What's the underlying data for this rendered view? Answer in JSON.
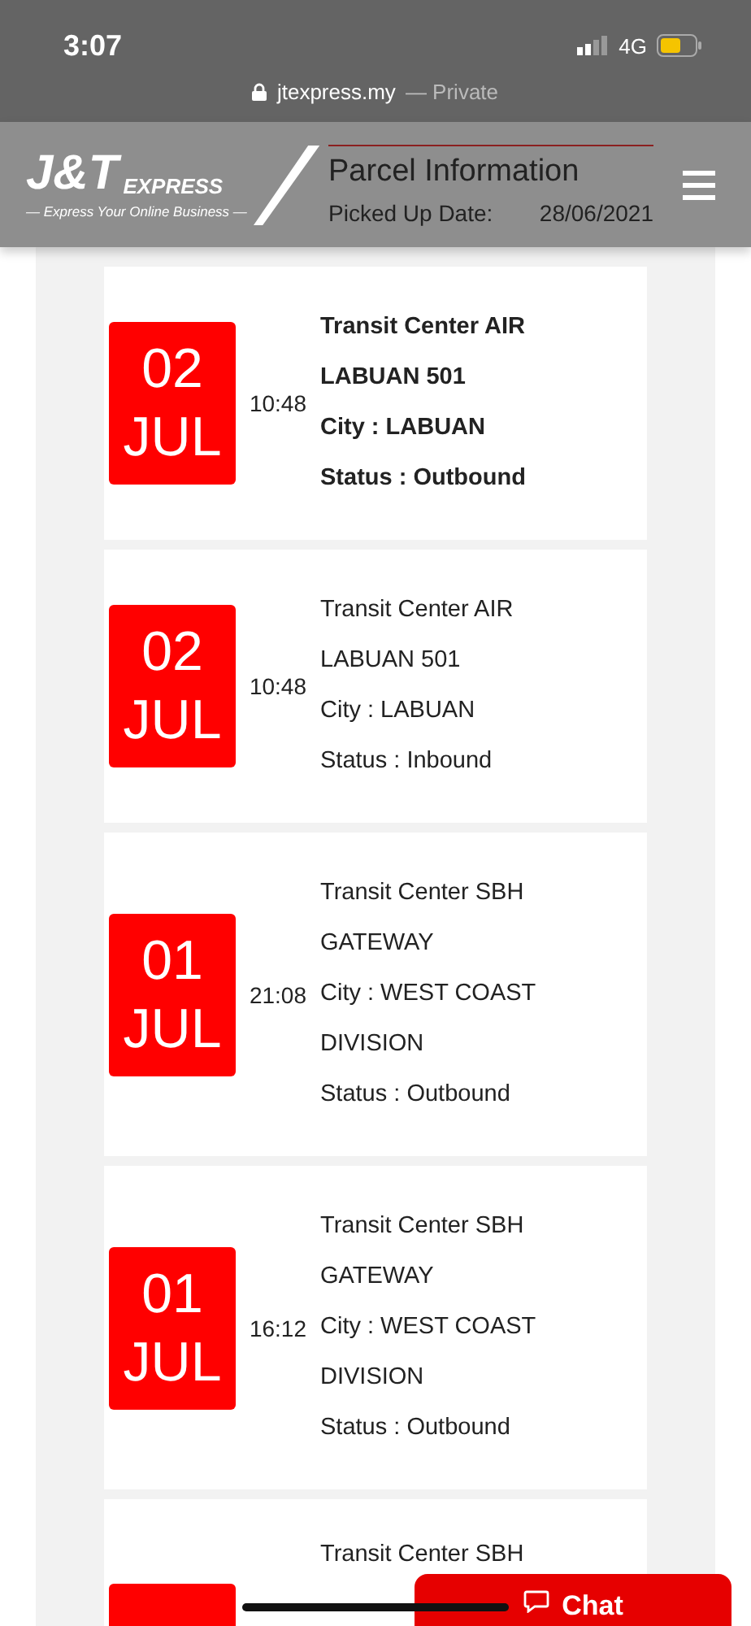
{
  "status_bar": {
    "time": "3:07",
    "network": "4G"
  },
  "url_bar": {
    "domain": "jtexpress.my",
    "mode": "— Private"
  },
  "header": {
    "logo": "J&T",
    "logo_word": "EXPRESS",
    "tagline": "— Express Your Online Business —"
  },
  "parcel": {
    "title": "Parcel Information",
    "picked_label": "Picked Up Date:",
    "picked_date": "28/06/2021"
  },
  "events": [
    {
      "day": "02",
      "month": "JUL",
      "time": "10:48",
      "latest": true,
      "lines": [
        "Transit Center AIR",
        "LABUAN 501",
        "City : LABUAN",
        "Status : Outbound"
      ]
    },
    {
      "day": "02",
      "month": "JUL",
      "time": "10:48",
      "latest": false,
      "lines": [
        "Transit Center AIR",
        "LABUAN 501",
        "City : LABUAN",
        "Status : Inbound"
      ]
    },
    {
      "day": "01",
      "month": "JUL",
      "time": "21:08",
      "latest": false,
      "lines": [
        "Transit Center SBH",
        "GATEWAY",
        "City : WEST COAST",
        "DIVISION",
        "Status : Outbound"
      ]
    },
    {
      "day": "01",
      "month": "JUL",
      "time": "16:12",
      "latest": false,
      "lines": [
        "Transit Center SBH",
        "GATEWAY",
        "City : WEST COAST",
        "DIVISION",
        "Status : Outbound"
      ]
    },
    {
      "latest": false,
      "lines": [
        "Transit Center SBH"
      ]
    }
  ],
  "chat_button": {
    "label": "Chat"
  }
}
